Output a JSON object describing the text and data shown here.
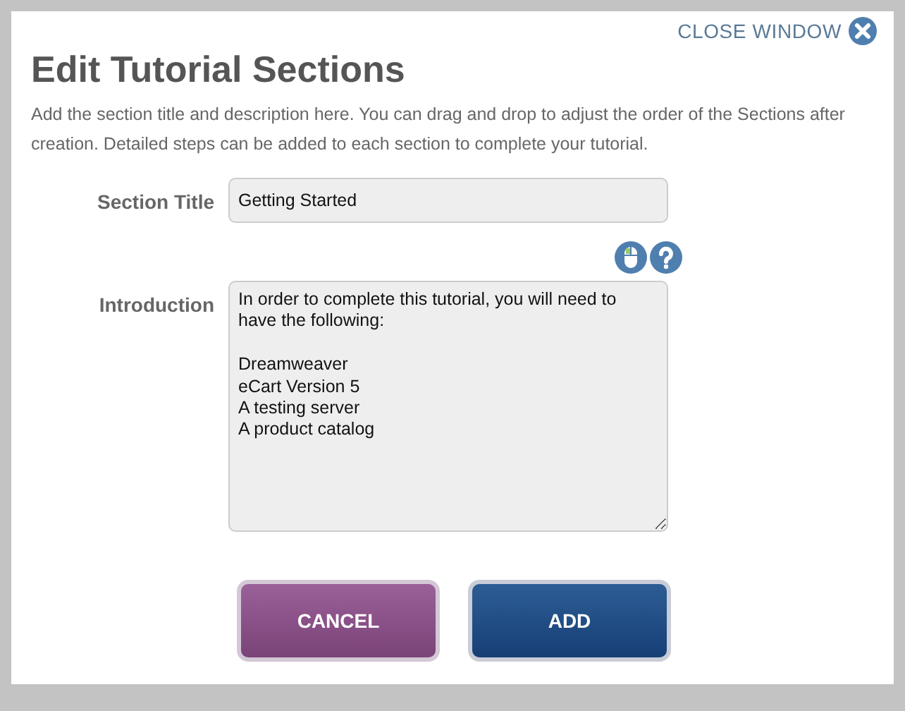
{
  "close_link": "CLOSE WINDOW",
  "title": "Edit Tutorial Sections",
  "description": "Add the section title and description here. You can drag and drop to adjust the order of the Sections after creation. Detailed steps can be added to each section to complete your tutorial.",
  "section_title": {
    "label": "Section Title",
    "value": "Getting Started"
  },
  "introduction": {
    "label": "Introduction",
    "value": "In order to complete this tutorial, you will need to have the following:\n\nDreamweaver\neCart Version 5\nA testing server\nA product catalog"
  },
  "buttons": [
    {
      "label": "CANCEL",
      "kind": "cancel"
    },
    {
      "label": "ADD",
      "kind": "add"
    }
  ]
}
